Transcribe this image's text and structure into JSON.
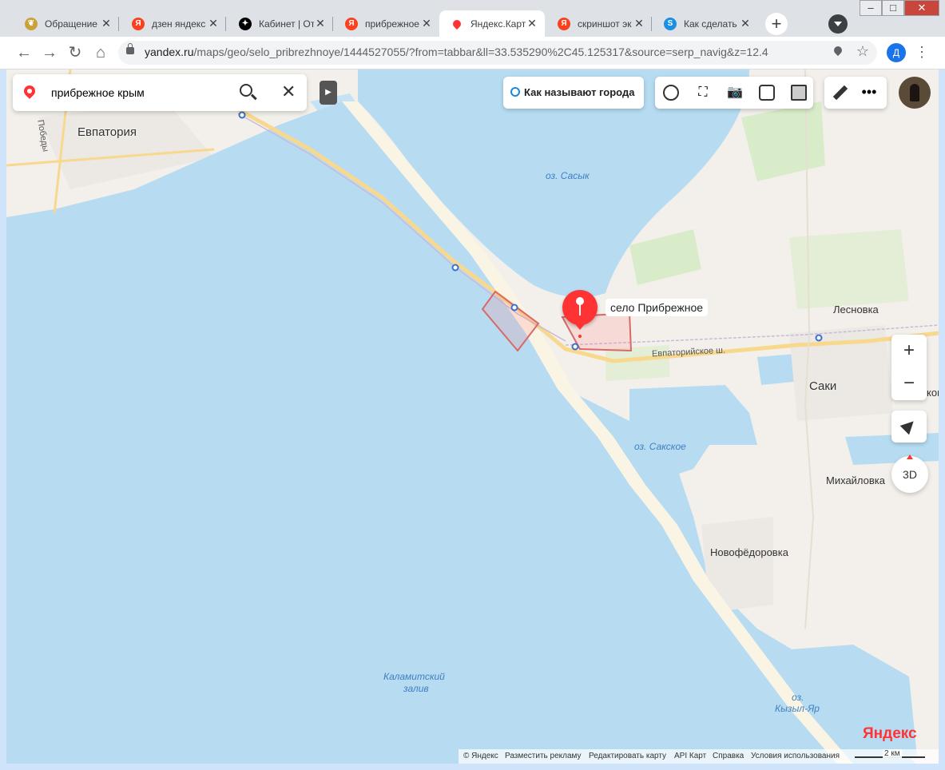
{
  "browser": {
    "tabs": [
      {
        "title": "Обращение",
        "icon": "gov-emblem-icon",
        "color": "#caa23a"
      },
      {
        "title": "дзен яндекс",
        "icon": "yandex-icon",
        "color": "#fc3f1d"
      },
      {
        "title": "Кабинет | От",
        "icon": "zen-icon",
        "color": "#000000"
      },
      {
        "title": "прибрежное",
        "icon": "yandex-icon",
        "color": "#fc3f1d"
      },
      {
        "title": "Яндекс.Карт",
        "icon": "maps-pin-icon",
        "color": "#ff3333",
        "active": true
      },
      {
        "title": "скриншот эк",
        "icon": "yandex-icon",
        "color": "#fc3f1d"
      },
      {
        "title": "Как сделать",
        "icon": "skype-icon",
        "color": "#1a8fe3"
      }
    ],
    "new_tab": "+",
    "url_host": "yandex.ru",
    "url_path": "/maps/geo/selo_pribrezhnoye/1444527055/?from=tabbar&ll=33.535290%2C45.125317&source=serp_navig&z=12.4",
    "profile_initial": "Д"
  },
  "map": {
    "search_query": "прибрежное крым",
    "city_names_button": "Как называют города",
    "marker_label": "село Прибрежное",
    "zoom_in": "+",
    "zoom_out": "−",
    "three_d": "3D",
    "labels": {
      "evpatoria": "Евпатория",
      "pobedy": "Победы",
      "sasyk": "оз. Сасык",
      "lesnovka": "Лесновка",
      "evpatoria_hwy": "Евпаторийское ш.",
      "saki": "Саки",
      "sakskoe": "оз. Сакское",
      "mikhailovka": "Михайловка",
      "novofedorovka": "Новофёдоровка",
      "kalamitsky": "Каламитский",
      "zaliv": "залив",
      "oz": "оз.",
      "kyzyl_yar": "Кызыл-Яр",
      "kov": "ков"
    },
    "brand": "Яндекс",
    "footer": [
      "© Яндекс",
      "Разместить рекламу",
      "Редактировать карту",
      "API Карт",
      "Справка",
      "Условия использования"
    ],
    "scale": "2 км"
  }
}
